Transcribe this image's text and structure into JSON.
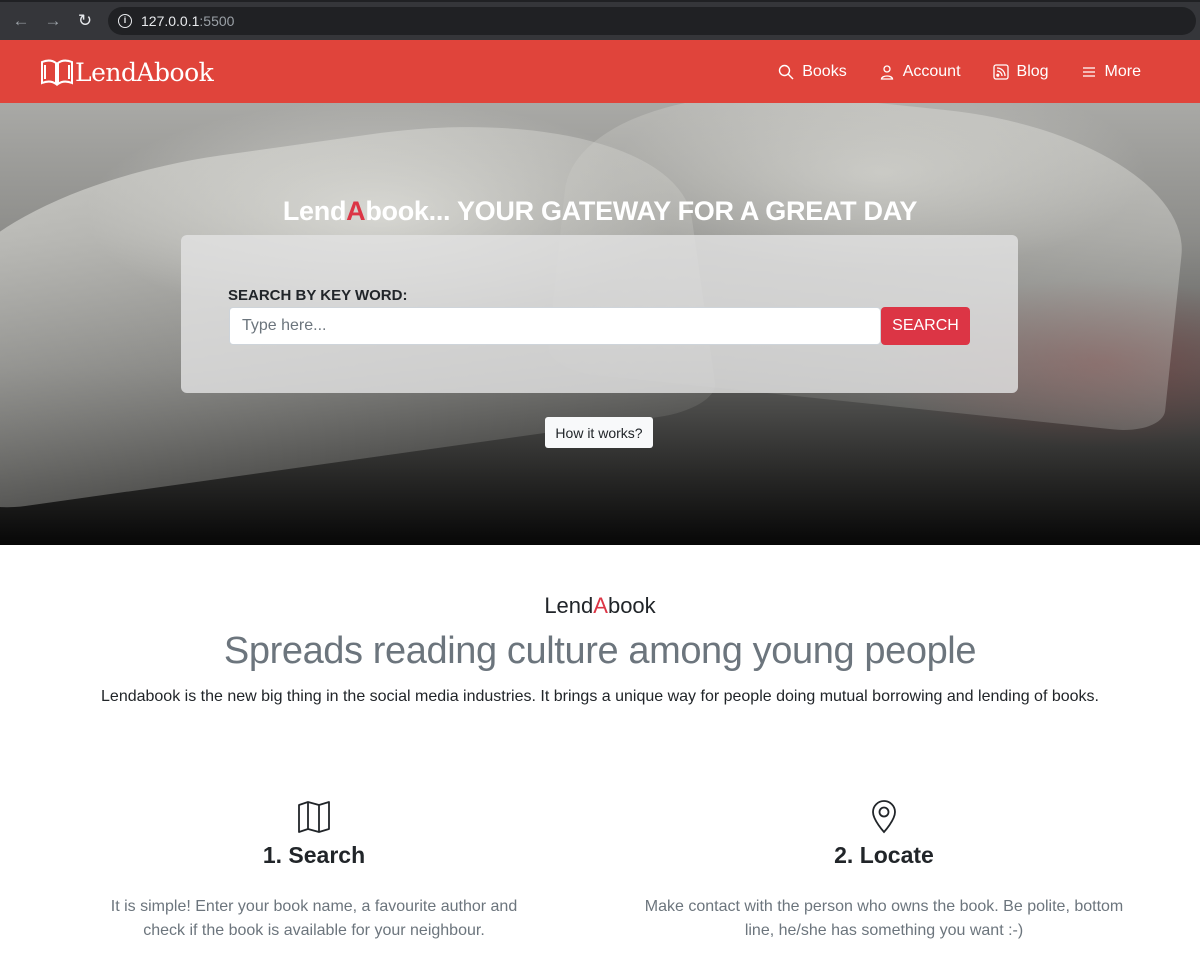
{
  "browser": {
    "back_icon": "arrow-left-icon",
    "forward_icon": "arrow-right-icon",
    "reload_icon": "reload-icon",
    "url_host": "127.0.0.1",
    "url_port": ":5500"
  },
  "navbar": {
    "brand": "LendAbook",
    "links": [
      {
        "label": "Books",
        "icon": "search-icon"
      },
      {
        "label": "Account",
        "icon": "person-icon"
      },
      {
        "label": "Blog",
        "icon": "rss-icon"
      },
      {
        "label": "More",
        "icon": "list-icon"
      }
    ],
    "color": "#e0443b"
  },
  "hero": {
    "title_part1": "Lend",
    "title_accent": "A",
    "title_part2": "book... YOUR GATEWAY FOR A GREAT DAY",
    "search_label": "SEARCH BY KEY WORD:",
    "search_placeholder": "Type here...",
    "search_button": "SEARCH",
    "how_button": "How it works?"
  },
  "about": {
    "brand_part1": "Lend",
    "brand_accent": "A",
    "brand_part2": "book",
    "headline": "Spreads reading culture among young people",
    "description": "Lendabook is the new big thing in the social media industries. It brings a unique way for people doing mutual borrowing and lending of books."
  },
  "features": [
    {
      "icon": "map-icon",
      "title": "1. Search",
      "text": "It is simple! Enter your book name, a favourite author and check if the book is available for your neighbour."
    },
    {
      "icon": "location-pin-icon",
      "title": "2. Locate",
      "text": "Make contact with the person who owns the book. Be polite, bottom line, he/she has something you want :-)"
    }
  ],
  "colors": {
    "accent_red": "#dc3545",
    "muted": "#6c757d"
  }
}
